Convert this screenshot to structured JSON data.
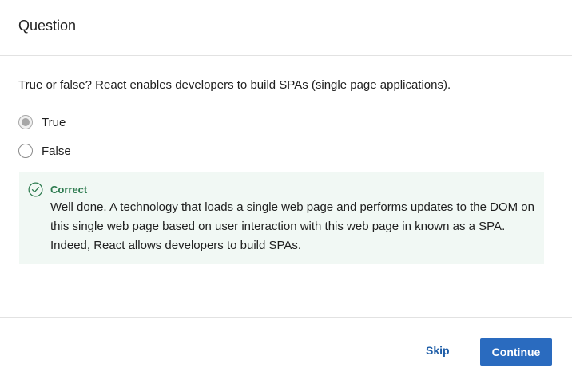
{
  "header": {
    "title": "Question"
  },
  "question": {
    "text": "True or false? React enables developers to build SPAs (single page applications).",
    "options": [
      {
        "label": "True",
        "selected": true
      },
      {
        "label": "False",
        "selected": false
      }
    ]
  },
  "feedback": {
    "status": "Correct",
    "icon": "check-circle-icon",
    "message": "Well done. A technology that loads a single web page and performs updates to the DOM on this single web page based on user interaction with this web page in known as a SPA. Indeed, React allows developers to build SPAs.",
    "color": "#2c7a4e",
    "background": "#f1f8f4"
  },
  "footer": {
    "skip_label": "Skip",
    "continue_label": "Continue",
    "accent": "#2a6bbf"
  }
}
